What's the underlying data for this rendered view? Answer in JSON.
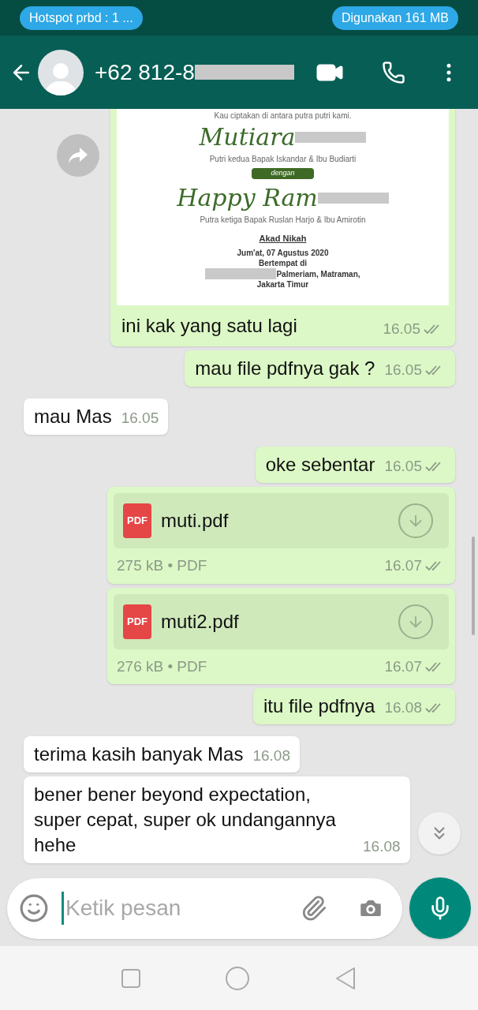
{
  "status_bar": {
    "left_pill": "Hotspot prbd : 1 ...",
    "right_pill": "Digunakan 161 MB"
  },
  "header": {
    "title": "+62 812-8",
    "redacted": true
  },
  "messages": [
    {
      "kind": "image",
      "outgoing": true,
      "forward": true,
      "caption": "ini kak yang satu lagi",
      "time": "16.05",
      "read": false,
      "invitation": [
        {
          "kind": "small",
          "text": "Kau ciptakan di antara putra putri kami."
        },
        {
          "kind": "script",
          "text": "Mutiara",
          "redacted_after": true
        },
        {
          "kind": "small",
          "text": "Putri kedua Bapak Iskandar & Ibu Budiarti"
        },
        {
          "kind": "tag",
          "text": "dengan"
        },
        {
          "kind": "script",
          "text": "Happy Ram",
          "redacted_after": true
        },
        {
          "kind": "small",
          "text": "Putra ketiga Bapak Ruslan Harjo & Ibu Amirotin"
        },
        {
          "kind": "heading",
          "text": "Akad Nikah"
        },
        {
          "kind": "body",
          "text": "Jum'at, 07 Agustus 2020"
        },
        {
          "kind": "body",
          "text": "Bertempat di"
        },
        {
          "kind": "body",
          "text": "Palmeriam, Matraman,",
          "redacted_before": true
        },
        {
          "kind": "body",
          "text": "Jakarta Timur"
        }
      ]
    },
    {
      "kind": "text",
      "outgoing": true,
      "text": "mau file pdfnya gak ?",
      "time": "16.05",
      "read": false
    },
    {
      "kind": "text",
      "outgoing": false,
      "text": "mau Mas",
      "time": "16.05"
    },
    {
      "kind": "text",
      "outgoing": true,
      "text": "oke sebentar",
      "time": "16.05",
      "read": false
    },
    {
      "kind": "document",
      "outgoing": true,
      "badge": "PDF",
      "filename": "muti.pdf",
      "meta": "275 kB • PDF",
      "time": "16.07",
      "read": false
    },
    {
      "kind": "document",
      "outgoing": true,
      "badge": "PDF",
      "filename": "muti2.pdf",
      "meta": "276 kB • PDF",
      "time": "16.07",
      "read": false
    },
    {
      "kind": "text",
      "outgoing": true,
      "text": "itu file pdfnya",
      "time": "16.08",
      "read": false
    },
    {
      "kind": "text",
      "outgoing": false,
      "text": "terima kasih banyak Mas",
      "time": "16.08"
    },
    {
      "kind": "text",
      "outgoing": false,
      "text": "bener bener beyond expectation, super cepat, super ok undangannya hehe",
      "time": "16.08"
    }
  ],
  "composer": {
    "placeholder": "Ketik pesan"
  }
}
